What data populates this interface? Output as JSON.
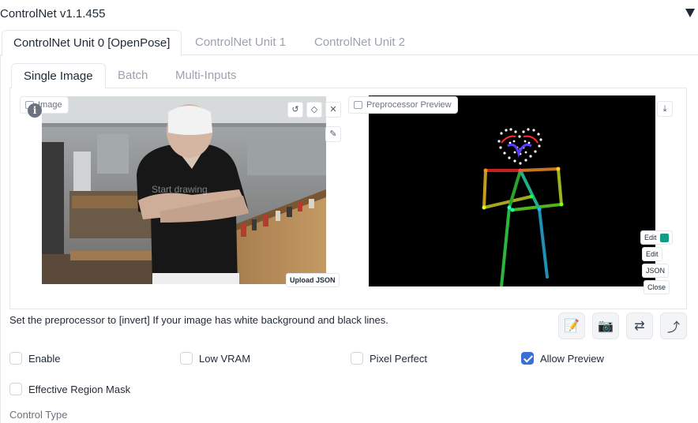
{
  "header": {
    "title": "ControlNet v1.1.455"
  },
  "unit_tabs": [
    {
      "label": "ControlNet Unit 0 [OpenPose]"
    },
    {
      "label": "ControlNet Unit 1"
    },
    {
      "label": "ControlNet Unit 2"
    }
  ],
  "mode_tabs": [
    {
      "label": "Single Image"
    },
    {
      "label": "Batch"
    },
    {
      "label": "Multi-Inputs"
    }
  ],
  "image_panel": {
    "label": "Image",
    "canvas_hint": "Start drawing",
    "upload_json_label": "Upload JSON"
  },
  "preview_panel": {
    "label": "Preprocessor Preview",
    "edit_label_1": "Edit",
    "edit_label_2": "Edit",
    "json_label": "JSON",
    "close_label": "Close"
  },
  "hint_text": "Set the preprocessor to [invert] If your image has white background and black lines.",
  "checkboxes": [
    {
      "label": "Enable",
      "checked": false
    },
    {
      "label": "Low VRAM",
      "checked": false
    },
    {
      "label": "Pixel Perfect",
      "checked": false
    },
    {
      "label": "Allow Preview",
      "checked": true
    },
    {
      "label": "Effective Region Mask",
      "checked": false
    }
  ],
  "control_type_label": "Control Type",
  "colors": {
    "accent": "#3b6fd8",
    "preview_bg": "#000000"
  }
}
